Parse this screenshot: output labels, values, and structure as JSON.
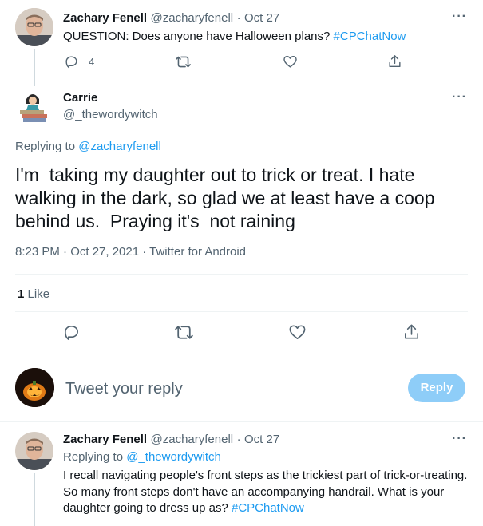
{
  "parent_tweet": {
    "author_name": "Zachary Fenell",
    "author_handle": "@zacharyfenell",
    "separator": "·",
    "date": "Oct 27",
    "text": "QUESTION: Does anyone have Halloween plans? ",
    "hashtag": "#CPChatNow",
    "reply_count": "4",
    "more_label": "···"
  },
  "main_tweet": {
    "author_name": "Carrie",
    "author_handle": "@_thewordywitch",
    "replying_prefix": "Replying to ",
    "replying_to": "@zacharyfenell",
    "text": "I'm  taking my daughter out to trick or treat. I hate walking in the dark, so glad we at least have a coop behind us.  Praying it's  not raining",
    "timestamp": "8:23 PM · Oct 27, 2021 · Twitter for Android",
    "like_count": "1",
    "like_label": "Like",
    "more_label": "···"
  },
  "composer": {
    "placeholder": "Tweet your reply",
    "reply_button": "Reply"
  },
  "reply_tweet": {
    "author_name": "Zachary Fenell",
    "author_handle": "@zacharyfenell",
    "separator": "·",
    "date": "Oct 27",
    "replying_prefix": "Replying to ",
    "replying_to": "@_thewordywitch",
    "text": "I recall navigating people's front steps as the trickiest part of trick-or-treating. So many front steps don't have an accompanying handrail. What is your daughter going to dress up as? ",
    "hashtag": "#CPChatNow",
    "more_label": "···"
  },
  "colors": {
    "accent": "#1d9bf0",
    "reply_button_disabled": "#8ecdf8",
    "muted_text": "#536471",
    "divider": "#eff3f4"
  },
  "icons": [
    "reply-icon",
    "retweet-icon",
    "like-icon",
    "share-icon",
    "more-icon"
  ]
}
